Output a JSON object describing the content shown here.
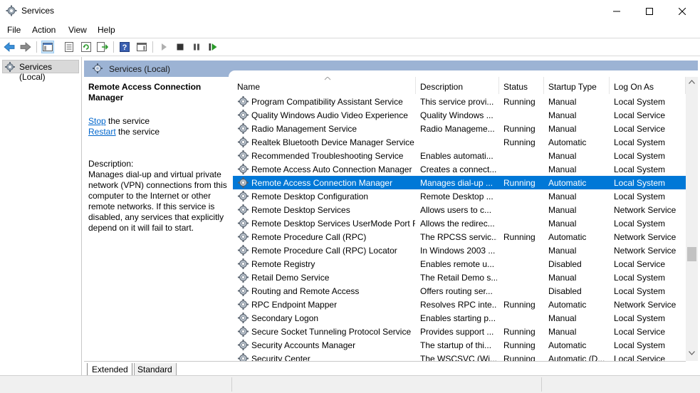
{
  "window": {
    "title": "Services"
  },
  "menu": {
    "items": [
      "File",
      "Action",
      "View",
      "Help"
    ]
  },
  "tree": {
    "root_label": "Services (Local)"
  },
  "panel": {
    "header_label": "Services (Local)"
  },
  "description": {
    "service_name": "Remote Access Connection Manager",
    "stop_link": "Stop",
    "stop_suffix": " the service",
    "restart_link": "Restart",
    "restart_suffix": " the service",
    "label": "Description:",
    "text": "Manages dial-up and virtual private network (VPN) connections from this computer to the Internet or other remote networks. If this service is disabled, any services that explicitly depend on it will fail to start."
  },
  "columns": [
    "Name",
    "Description",
    "Status",
    "Startup Type",
    "Log On As"
  ],
  "rows": [
    {
      "name": "Program Compatibility Assistant Service",
      "description": "This service provi...",
      "status": "Running",
      "startup": "Manual",
      "logon": "Local System"
    },
    {
      "name": "Quality Windows Audio Video Experience",
      "description": "Quality Windows ...",
      "status": "",
      "startup": "Manual",
      "logon": "Local Service"
    },
    {
      "name": "Radio Management Service",
      "description": "Radio Manageme...",
      "status": "Running",
      "startup": "Manual",
      "logon": "Local Service"
    },
    {
      "name": "Realtek Bluetooth Device Manager Service",
      "description": "",
      "status": "Running",
      "startup": "Automatic",
      "logon": "Local System"
    },
    {
      "name": "Recommended Troubleshooting Service",
      "description": "Enables automati...",
      "status": "",
      "startup": "Manual",
      "logon": "Local System"
    },
    {
      "name": "Remote Access Auto Connection Manager",
      "description": "Creates a connect...",
      "status": "",
      "startup": "Manual",
      "logon": "Local System"
    },
    {
      "name": "Remote Access Connection Manager",
      "description": "Manages dial-up ...",
      "status": "Running",
      "startup": "Automatic",
      "logon": "Local System",
      "selected": true
    },
    {
      "name": "Remote Desktop Configuration",
      "description": "Remote Desktop ...",
      "status": "",
      "startup": "Manual",
      "logon": "Local System"
    },
    {
      "name": "Remote Desktop Services",
      "description": "Allows users to c...",
      "status": "",
      "startup": "Manual",
      "logon": "Network Service"
    },
    {
      "name": "Remote Desktop Services UserMode Port R...",
      "description": "Allows the redirec...",
      "status": "",
      "startup": "Manual",
      "logon": "Local System"
    },
    {
      "name": "Remote Procedure Call (RPC)",
      "description": "The RPCSS servic...",
      "status": "Running",
      "startup": "Automatic",
      "logon": "Network Service"
    },
    {
      "name": "Remote Procedure Call (RPC) Locator",
      "description": "In Windows 2003 ...",
      "status": "",
      "startup": "Manual",
      "logon": "Network Service"
    },
    {
      "name": "Remote Registry",
      "description": "Enables remote u...",
      "status": "",
      "startup": "Disabled",
      "logon": "Local Service"
    },
    {
      "name": "Retail Demo Service",
      "description": "The Retail Demo s...",
      "status": "",
      "startup": "Manual",
      "logon": "Local System"
    },
    {
      "name": "Routing and Remote Access",
      "description": "Offers routing ser...",
      "status": "",
      "startup": "Disabled",
      "logon": "Local System"
    },
    {
      "name": "RPC Endpoint Mapper",
      "description": "Resolves RPC inte...",
      "status": "Running",
      "startup": "Automatic",
      "logon": "Network Service"
    },
    {
      "name": "Secondary Logon",
      "description": "Enables starting p...",
      "status": "",
      "startup": "Manual",
      "logon": "Local System"
    },
    {
      "name": "Secure Socket Tunneling Protocol Service",
      "description": "Provides support ...",
      "status": "Running",
      "startup": "Manual",
      "logon": "Local Service"
    },
    {
      "name": "Security Accounts Manager",
      "description": "The startup of thi...",
      "status": "Running",
      "startup": "Automatic",
      "logon": "Local System"
    },
    {
      "name": "Security Center",
      "description": "The WSCSVC (Wi...",
      "status": "Running",
      "startup": "Automatic (D...",
      "logon": "Local Service"
    }
  ],
  "bottom_tabs": [
    "Extended",
    "Standard"
  ],
  "colors": {
    "selection": "#0078d7",
    "panel_header": "#9cb3d4",
    "link": "#0066cc"
  }
}
